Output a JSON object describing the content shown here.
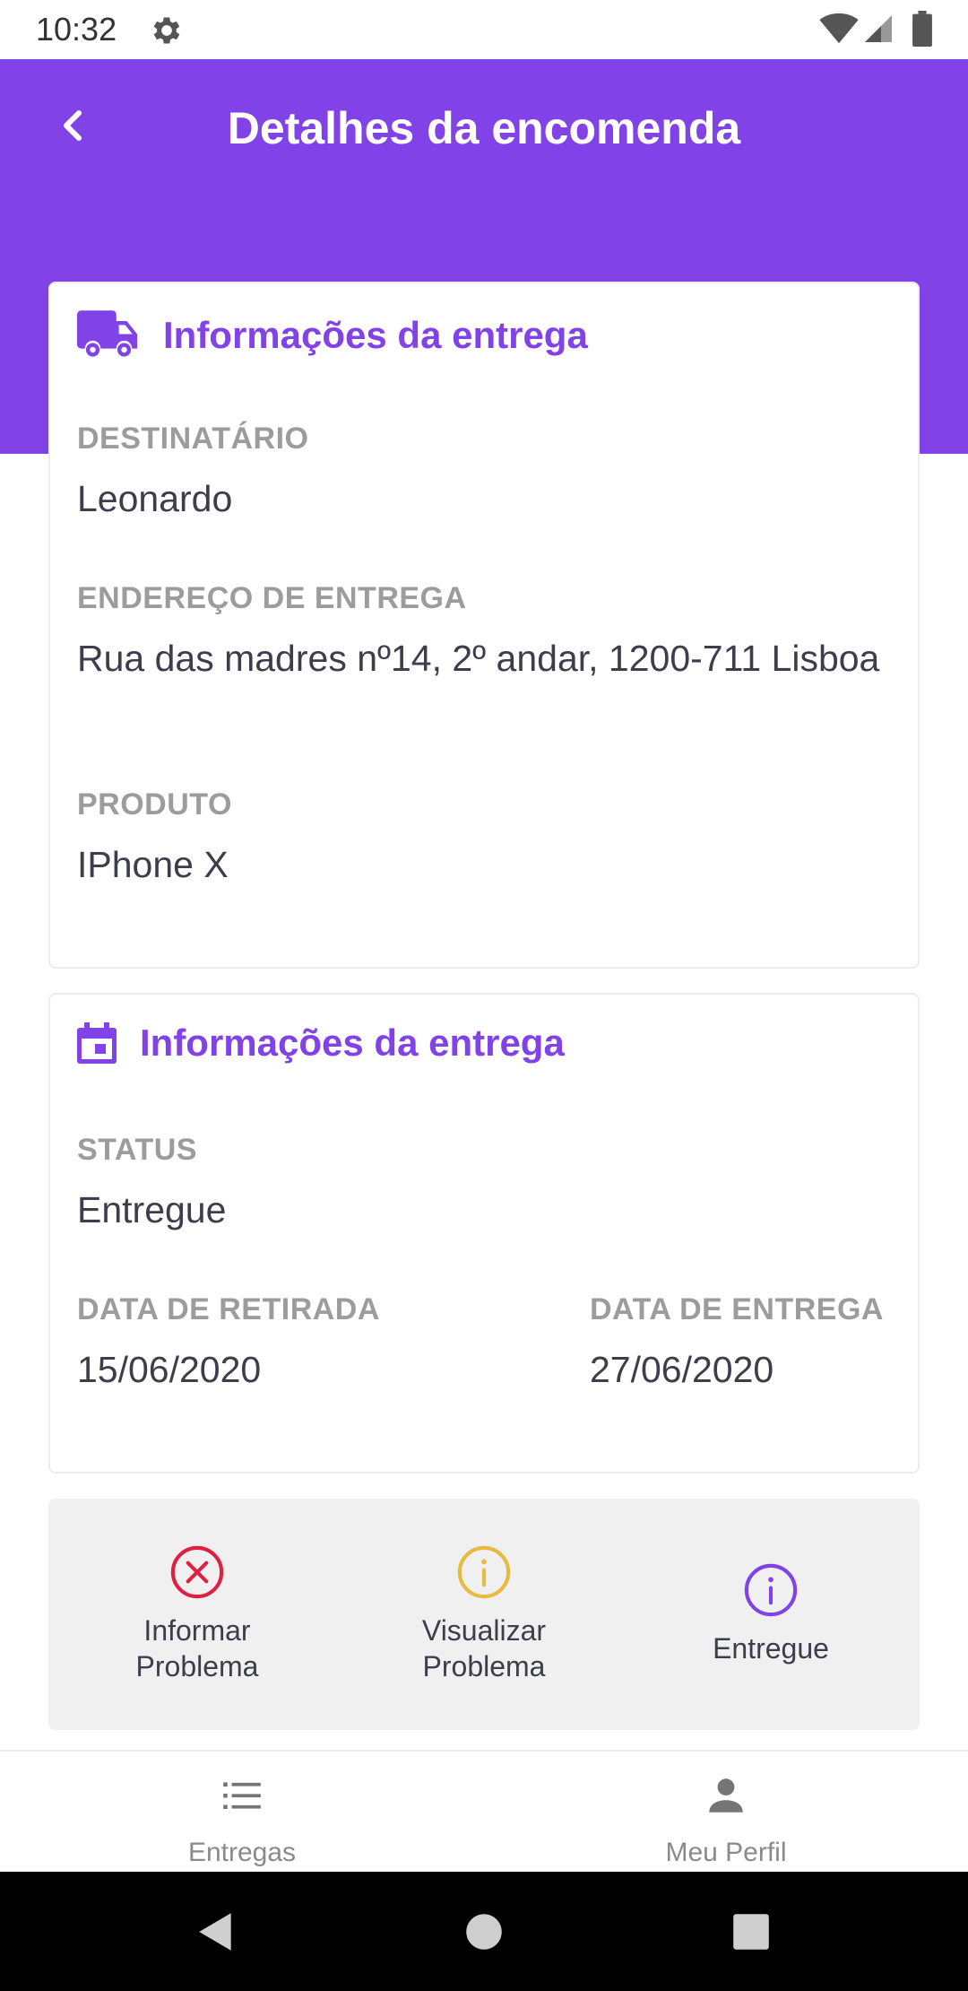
{
  "status_bar": {
    "time": "10:32",
    "icons": [
      "gear-icon",
      "wifi-icon",
      "signal-icon",
      "battery-icon"
    ]
  },
  "header": {
    "title": "Detalhes da encomenda",
    "back_icon": "chevron-left-icon"
  },
  "delivery_card": {
    "icon": "truck-icon",
    "title": "Informações da entrega",
    "recipient_label": "DESTINATÁRIO",
    "recipient_value": "Leonardo",
    "address_label": "ENDEREÇO DE ENTREGA",
    "address_value": "Rua das madres nº14, 2º andar, 1200-711 Lisboa",
    "product_label": "PRODUTO",
    "product_value": "IPhone X"
  },
  "status_card": {
    "icon": "calendar-icon",
    "title": "Informações da entrega",
    "status_label": "STATUS",
    "status_value": "Entregue",
    "pickup_label": "DATA DE RETIRADA",
    "pickup_value": "15/06/2020",
    "delivery_label": "DATA DE ENTREGA",
    "delivery_value": "27/06/2020"
  },
  "actions": [
    {
      "label": "Informar Problema",
      "icon": "x-circle-icon",
      "color": "#e02041"
    },
    {
      "label": "Visualizar Problema",
      "icon": "info-circle-icon",
      "color": "#e7ba40"
    },
    {
      "label": "Entregue",
      "icon": "info-circle-icon",
      "color": "#8142e8"
    }
  ],
  "bottom_nav": [
    {
      "label": "Entregas",
      "icon": "list-icon"
    },
    {
      "label": "Meu Perfil",
      "icon": "person-icon"
    }
  ],
  "colors": {
    "primary": "#8142e8",
    "label_gray": "#9c9c9c",
    "text": "#3d3d4c",
    "panel_bg": "#f0f0f0"
  }
}
